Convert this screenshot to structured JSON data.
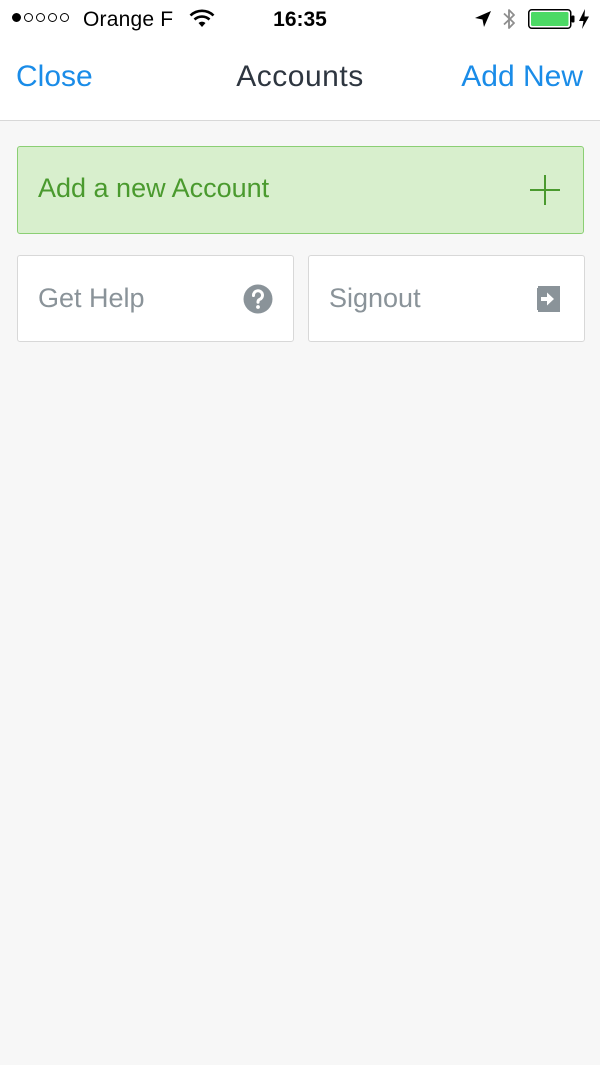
{
  "status_bar": {
    "carrier": "Orange F",
    "time": "16:35",
    "signal_dots_filled": 1,
    "signal_dots_total": 5,
    "battery_level": 1.0,
    "charging": true
  },
  "nav": {
    "left_label": "Close",
    "title": "Accounts",
    "right_label": "Add New"
  },
  "actions": {
    "add_account_label": "Add a new Account",
    "help_label": "Get Help",
    "signout_label": "Signout"
  },
  "icons": {
    "signal": "signal-dots-icon",
    "wifi": "wifi-icon",
    "location": "location-arrow-icon",
    "bluetooth": "bluetooth-icon",
    "battery": "battery-icon",
    "charging": "charging-bolt-icon",
    "add": "plus-icon",
    "help": "question-circle-icon",
    "signout": "sign-out-icon"
  },
  "colors": {
    "accent_blue": "#1a8ce8",
    "success_green": "#4a9a2e",
    "success_bg": "#d8efcd",
    "battery_green": "#4cd964",
    "muted_gray": "#8a9399"
  }
}
